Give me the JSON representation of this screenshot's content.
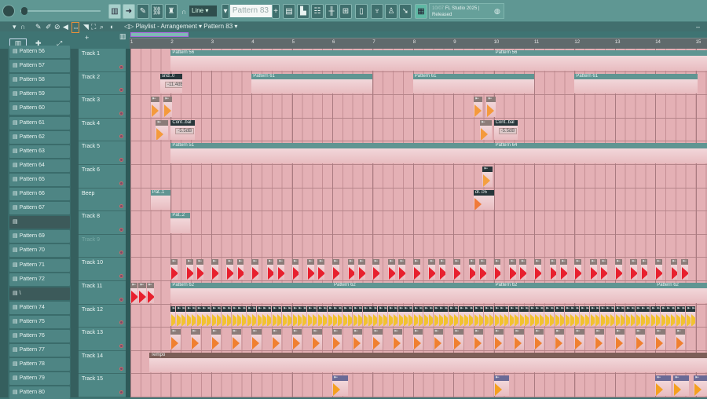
{
  "toolbar": {
    "snap_label": "Line",
    "pattern_label": "Pattern 83",
    "hint_date": "10/07",
    "hint_text": "FL Studio 2025 |",
    "hint_text2": "Released"
  },
  "playlist": {
    "title": "Playlist - Arrangement",
    "pattern": "Pattern 83"
  },
  "ruler": [
    "1",
    "2",
    "3",
    "4",
    "5",
    "6",
    "7",
    "8",
    "9",
    "10",
    "11",
    "12",
    "13",
    "14",
    "15"
  ],
  "patterns": [
    "Pattern 56",
    "Pattern 57",
    "Pattern 58",
    "Pattern 59",
    "Pattern 60",
    "Pattern 61",
    "Pattern 62",
    "Pattern 63",
    "Pattern 64",
    "Pattern 65",
    "Pattern 66",
    "Pattern 67",
    "",
    "Pattern 69",
    "Pattern 70",
    "Pattern 71",
    "Pattern 72",
    "\\",
    "Pattern 74",
    "Pattern 75",
    "Pattern 76",
    "Pattern 77",
    "Pattern 78",
    "Pattern 79",
    "Pattern 80"
  ],
  "tracks": [
    "Track 1",
    "Track 2",
    "Track 3",
    "Track 4",
    "Track 5",
    "Track 6",
    "Beep",
    "Track 8",
    "Track 9",
    "Track 10",
    "Track 11",
    "Track 12",
    "Track 13",
    "Track 14",
    "Track 15"
  ],
  "clips": [
    {
      "t": 0,
      "s": 2,
      "l": 8,
      "k": "pattern",
      "n": "Pattern 56"
    },
    {
      "t": 0,
      "s": 10,
      "l": 6,
      "k": "pattern",
      "n": "Pattern 56"
    },
    {
      "t": 1,
      "s": 1.74,
      "l": 0.55,
      "k": "dark",
      "n": "snd..0",
      "db": "-11.4dB"
    },
    {
      "t": 1,
      "s": 4,
      "l": 3,
      "k": "pattern",
      "n": "Pattern 61"
    },
    {
      "t": 1,
      "s": 8,
      "l": 3,
      "k": "pattern",
      "n": "Pattern 61"
    },
    {
      "t": 1,
      "s": 12,
      "l": 3.05,
      "k": "pattern",
      "n": "Pattern 61"
    },
    {
      "t": 2,
      "s": 1.5,
      "l": 0.22,
      "k": "audio",
      "n": "",
      "c": "#f49a3c"
    },
    {
      "t": 2,
      "s": 1.82,
      "l": 0.22,
      "k": "audio",
      "n": "",
      "c": "#f49a3c"
    },
    {
      "t": 2,
      "s": 9.5,
      "l": 0.22,
      "k": "audio",
      "n": "",
      "c": "#f49a3c"
    },
    {
      "t": 2,
      "s": 9.82,
      "l": 0.22,
      "k": "audio",
      "n": "",
      "c": "#f49a3c"
    },
    {
      "t": 3,
      "s": 1.63,
      "l": 0.3,
      "k": "audio",
      "n": "",
      "c": "#f49a3c"
    },
    {
      "t": 3,
      "s": 2,
      "l": 0.6,
      "k": "dark",
      "n": "Cont..bal",
      "db": "-5.5dB"
    },
    {
      "t": 3,
      "s": 9.65,
      "l": 0.3,
      "k": "audio",
      "n": "",
      "c": "#f49a3c"
    },
    {
      "t": 3,
      "s": 10,
      "l": 0.6,
      "k": "dark",
      "n": "Cont..bal",
      "db": "-5.5dB"
    },
    {
      "t": 4,
      "s": 2,
      "l": 8,
      "k": "pattern",
      "n": "Pattern 51"
    },
    {
      "t": 4,
      "s": 10,
      "l": 6,
      "k": "pattern",
      "n": "Pattern 64"
    },
    {
      "t": 5,
      "s": 9.72,
      "l": 0.24,
      "k": "dark",
      "n": "",
      "c": "#f4a040"
    },
    {
      "t": 6,
      "s": 1.5,
      "l": 0.5,
      "k": "pattern",
      "n": "Pat..1"
    },
    {
      "t": 6,
      "s": 9.5,
      "l": 0.5,
      "k": "dark",
      "n": "dr..05",
      "c": "#f07a3a"
    },
    {
      "t": 7,
      "s": 2,
      "l": 0.48,
      "k": "pattern",
      "n": "Pat..2"
    },
    {
      "t": 10,
      "s": 1,
      "l": 0.18,
      "k": "audio",
      "n": "",
      "c": "#e8202e"
    },
    {
      "t": 10,
      "s": 1.2,
      "l": 0.18,
      "k": "audio",
      "n": "",
      "c": "#e8202e"
    },
    {
      "t": 10,
      "s": 1.4,
      "l": 0.18,
      "k": "audio",
      "n": "",
      "c": "#e8202e"
    },
    {
      "t": 10,
      "s": 2,
      "l": 4,
      "k": "pattern",
      "n": "Pattern 62"
    },
    {
      "t": 10,
      "s": 6,
      "l": 4,
      "k": "pattern",
      "n": "Pattern 62"
    },
    {
      "t": 10,
      "s": 10,
      "l": 4,
      "k": "pattern",
      "n": "Pattern 62"
    },
    {
      "t": 10,
      "s": 14,
      "l": 2,
      "k": "pattern",
      "n": "Pattern 62"
    },
    {
      "t": 13,
      "s": 1.47,
      "l": 14.6,
      "k": "auto",
      "n": "Tempo"
    },
    {
      "t": 14,
      "s": 6,
      "l": 0.38,
      "k": "purple",
      "n": "",
      "c": "#f4a020"
    },
    {
      "t": 14,
      "s": 10,
      "l": 0.38,
      "k": "purple",
      "n": "",
      "c": "#f4a020"
    },
    {
      "t": 14,
      "s": 14,
      "l": 0.38,
      "k": "purple",
      "n": "",
      "c": "#f4a020"
    },
    {
      "t": 14,
      "s": 14.45,
      "l": 0.38,
      "k": "purple",
      "n": "",
      "c": "#f4a020"
    },
    {
      "t": 14,
      "s": 14.95,
      "l": 0.38,
      "k": "purple",
      "n": "",
      "c": "#f4a020"
    }
  ],
  "repeats": [
    {
      "t": 9,
      "from": 2,
      "to": 15,
      "offsets": [
        0,
        0.38,
        0.64
      ],
      "l": 0.17,
      "k": "audio",
      "c": "#e8202e"
    },
    {
      "t": 9,
      "from": 1.62,
      "to": 1.63,
      "offsets": [
        0
      ],
      "l": 0.17,
      "k": "audio",
      "c": "#e8202e"
    },
    {
      "t": 11,
      "from": 2,
      "to": 15,
      "offsets": [
        0,
        0.125,
        0.25,
        0.375,
        0.5,
        0.625,
        0.75,
        0.875
      ],
      "l": 0.11,
      "k": "dark",
      "c": "#f2c230"
    },
    {
      "t": 12,
      "from": 2,
      "to": 15,
      "offsets": [
        0,
        0.5
      ],
      "l": 0.24,
      "k": "audio",
      "c": "#f08030"
    }
  ]
}
